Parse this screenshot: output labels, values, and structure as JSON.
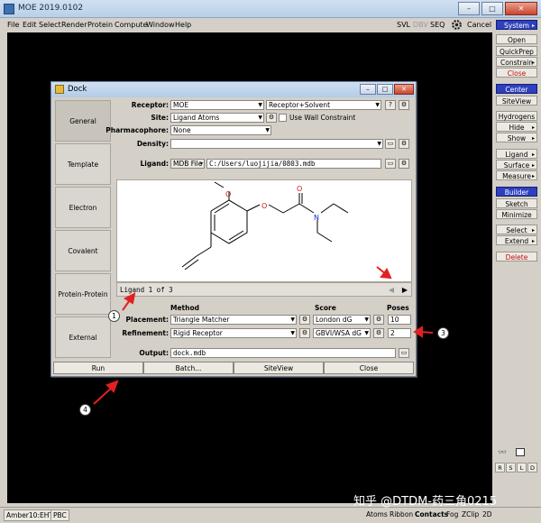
{
  "app": {
    "title": "MOE 2019.0102"
  },
  "menu": [
    "File",
    "Edit",
    "Select",
    "Render",
    "Protein",
    "Compute",
    "Window",
    "Help"
  ],
  "toolbar": {
    "svl": "SVL",
    "dbv": "DBV",
    "seq": "SEQ",
    "cancel": "Cancel",
    "system": "System"
  },
  "side_panel": {
    "open": "Open",
    "quickprep": "QuickPrep",
    "constrain": "Constrain",
    "close": "Close",
    "center": "Center",
    "siteview": "SiteView",
    "hydrogens": "Hydrogens",
    "hide": "Hide",
    "show": "Show",
    "ligand": "Ligand",
    "surface": "Surface",
    "measure": "Measure",
    "builder": "Builder",
    "sketch": "Sketch",
    "minimize": "Minimize",
    "select": "Select",
    "extend": "Extend",
    "delete": "Delete",
    "rsl": [
      "R",
      "S",
      "L",
      "D"
    ]
  },
  "status": {
    "amber": "Amber10:EHT",
    "pbc": "PBC",
    "tools": [
      "Atoms",
      "Ribbon",
      "Contacts",
      "Fog",
      "ZClip",
      "2D"
    ]
  },
  "dock": {
    "title": "Dock",
    "tabs": [
      "General",
      "Template",
      "Electron Density",
      "Covalent",
      "Protein-Protein",
      "External"
    ],
    "receptor": {
      "label": "Receptor:",
      "value": "MOE",
      "value2": "Receptor+Solvent"
    },
    "site": {
      "label": "Site:",
      "value": "Ligand Atoms",
      "wall_label": "Use Wall Constraint"
    },
    "pharmacophore": {
      "label": "Pharmacophore:",
      "value": "None"
    },
    "density": {
      "label": "Density:",
      "value": ""
    },
    "ligand": {
      "label": "Ligand:",
      "source": "MDB File",
      "path": "C:/Users/luojijia/0803.mdb"
    },
    "ligand_counter": "Ligand 1 of 3",
    "headers": {
      "method": "Method",
      "score": "Score",
      "poses": "Poses"
    },
    "placement": {
      "label": "Placement:",
      "method": "Triangle Matcher",
      "score": "London dG",
      "poses": "10"
    },
    "refinement": {
      "label": "Refinement:",
      "method": "Rigid Receptor",
      "score": "GBVI/WSA dG",
      "poses": "2"
    },
    "output": {
      "label": "Output:",
      "value": "dock.mdb"
    },
    "buttons": {
      "run": "Run",
      "batch": "Batch...",
      "siteview": "SiteView",
      "close": "Close"
    }
  },
  "molecule": {
    "atom_labels": {
      "o1": "O",
      "o2": "O",
      "o3": "O",
      "n": "N"
    }
  },
  "annotations": [
    "1",
    "2",
    "3",
    "4"
  ],
  "watermark": "知乎 @DTDM-药三角0215",
  "colors": {
    "selected_blue": "#2e3fbf",
    "annotation_red": "#e32020",
    "delete_red": "#c01010",
    "viewport": "#000000"
  }
}
